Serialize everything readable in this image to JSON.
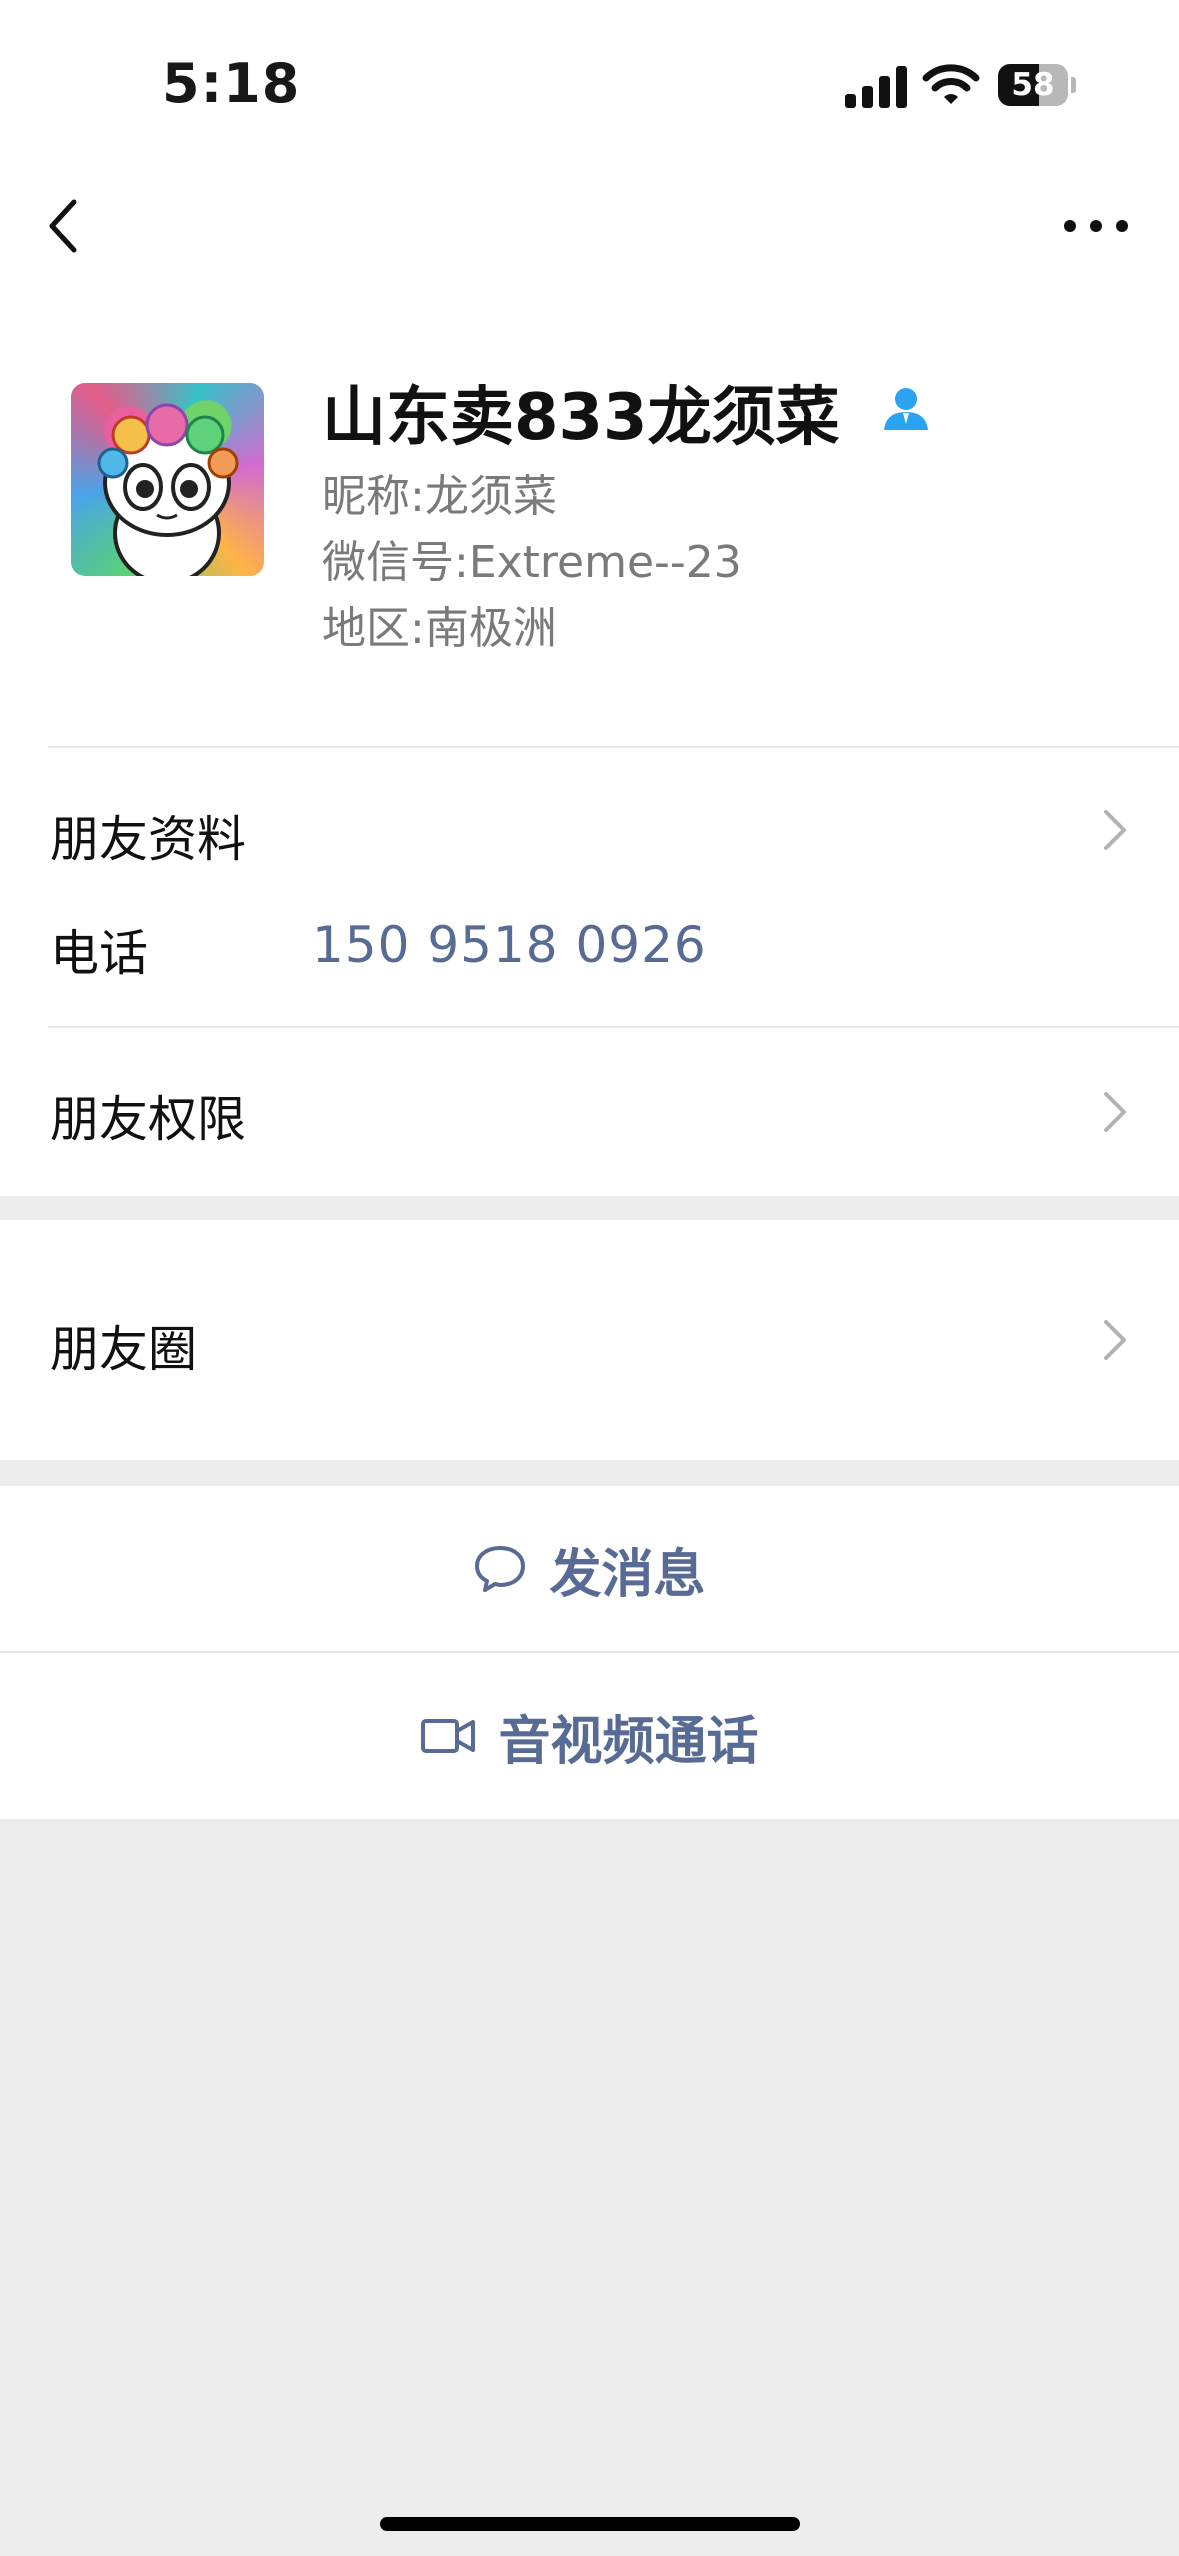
{
  "status_bar": {
    "time": "5:18",
    "battery": "58",
    "battery_level": 0.58,
    "icons": [
      "cellular-signal-icon",
      "wifi-icon",
      "battery-icon"
    ]
  },
  "nav": {
    "back_icon": "chevron-left-icon",
    "more_icon": "more-icon"
  },
  "profile": {
    "name": "山东卖833龙须菜",
    "nickname_label": "昵称:",
    "nickname": "龙须菜",
    "wechat_id_label": "微信号:",
    "wechat_id": "Extreme--23",
    "region_label": "地区:",
    "region": "南极洲"
  },
  "rows": {
    "friend_info": "朋友资料",
    "phone_label": "电话",
    "phone_value": "150 9518 0926",
    "friend_permissions": "朋友权限",
    "moments": "朋友圈"
  },
  "actions": {
    "send_message": "发消息",
    "av_call": "音视频通话"
  },
  "colors": {
    "link": "#576b95",
    "background": "#ededed",
    "card": "#ffffff",
    "badge": "#2aa3f0"
  }
}
